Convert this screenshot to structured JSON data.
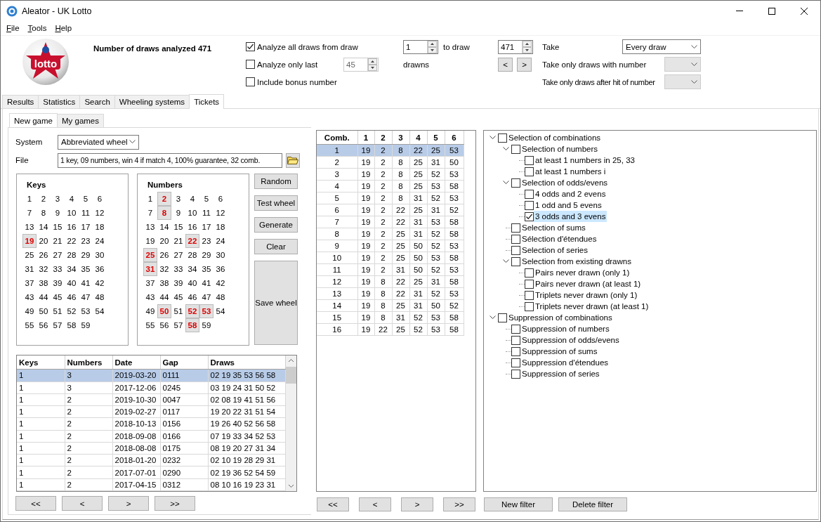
{
  "window": {
    "title": "Aleator - UK Lotto"
  },
  "menu": [
    "File",
    "Tools",
    "Help"
  ],
  "header": {
    "logo_text": "lotto",
    "summary": "Number of draws analyzed 471",
    "analyze_all": {
      "label": "Analyze all draws from draw",
      "checked": true
    },
    "from_draw": "1",
    "to_draw_label": "to draw",
    "to_draw": "471",
    "analyze_last": {
      "label": "Analyze only last",
      "checked": false
    },
    "last_count": {
      "value": "45",
      "disabled": true
    },
    "drawns_label": "drawns",
    "include_bonus": {
      "label": "Include bonus number",
      "checked": false
    },
    "prev": "<",
    "next": ">",
    "take_label": "Take",
    "take_value": "Every draw",
    "with_number": {
      "label": "Take only draws with number",
      "disabled": true
    },
    "after_hit": {
      "label": "Take only draws after hit of number",
      "disabled": true
    }
  },
  "tabs": [
    {
      "label": "Results",
      "selected": false
    },
    {
      "label": "Statistics",
      "selected": false
    },
    {
      "label": "Search",
      "selected": false
    },
    {
      "label": "Wheeling systems",
      "selected": false
    },
    {
      "label": "Tickets",
      "selected": true
    }
  ],
  "subtabs": [
    {
      "label": "New game",
      "selected": true
    },
    {
      "label": "My games",
      "selected": false
    }
  ],
  "system": {
    "label": "System",
    "value": "Abbreviated wheel"
  },
  "file": {
    "label": "File",
    "value": "1 key, 09 numbers, win 4 if match 4, 100% guarantee, 32 comb."
  },
  "keys": {
    "title": "Keys",
    "numbers": [
      {
        "n": "1",
        "selected": false
      },
      {
        "n": "2",
        "selected": false
      },
      {
        "n": "3",
        "selected": false
      },
      {
        "n": "4",
        "selected": false
      },
      {
        "n": "5",
        "selected": false
      },
      {
        "n": "6",
        "selected": false
      },
      {
        "n": "7",
        "selected": false
      },
      {
        "n": "8",
        "selected": false
      },
      {
        "n": "9",
        "selected": false
      },
      {
        "n": "10",
        "selected": false
      },
      {
        "n": "11",
        "selected": false
      },
      {
        "n": "12",
        "selected": false
      },
      {
        "n": "13",
        "selected": false
      },
      {
        "n": "14",
        "selected": false
      },
      {
        "n": "15",
        "selected": false
      },
      {
        "n": "16",
        "selected": false
      },
      {
        "n": "17",
        "selected": false
      },
      {
        "n": "18",
        "selected": false
      },
      {
        "n": "19",
        "selected": true
      },
      {
        "n": "20",
        "selected": false
      },
      {
        "n": "21",
        "selected": false
      },
      {
        "n": "22",
        "selected": false
      },
      {
        "n": "23",
        "selected": false
      },
      {
        "n": "24",
        "selected": false
      },
      {
        "n": "25",
        "selected": false
      },
      {
        "n": "26",
        "selected": false
      },
      {
        "n": "27",
        "selected": false
      },
      {
        "n": "28",
        "selected": false
      },
      {
        "n": "29",
        "selected": false
      },
      {
        "n": "30",
        "selected": false
      },
      {
        "n": "31",
        "selected": false
      },
      {
        "n": "32",
        "selected": false
      },
      {
        "n": "33",
        "selected": false
      },
      {
        "n": "34",
        "selected": false
      },
      {
        "n": "35",
        "selected": false
      },
      {
        "n": "36",
        "selected": false
      },
      {
        "n": "37",
        "selected": false
      },
      {
        "n": "38",
        "selected": false
      },
      {
        "n": "39",
        "selected": false
      },
      {
        "n": "40",
        "selected": false
      },
      {
        "n": "41",
        "selected": false
      },
      {
        "n": "42",
        "selected": false
      },
      {
        "n": "43",
        "selected": false
      },
      {
        "n": "44",
        "selected": false
      },
      {
        "n": "45",
        "selected": false
      },
      {
        "n": "46",
        "selected": false
      },
      {
        "n": "47",
        "selected": false
      },
      {
        "n": "48",
        "selected": false
      },
      {
        "n": "49",
        "selected": false
      },
      {
        "n": "50",
        "selected": false
      },
      {
        "n": "51",
        "selected": false
      },
      {
        "n": "52",
        "selected": false
      },
      {
        "n": "53",
        "selected": false
      },
      {
        "n": "54",
        "selected": false
      },
      {
        "n": "55",
        "selected": false
      },
      {
        "n": "56",
        "selected": false
      },
      {
        "n": "57",
        "selected": false
      },
      {
        "n": "58",
        "selected": false
      },
      {
        "n": "59",
        "selected": false
      }
    ]
  },
  "numbers": {
    "title": "Numbers",
    "numbers": [
      {
        "n": "1",
        "selected": false
      },
      {
        "n": "2",
        "selected": true
      },
      {
        "n": "3",
        "selected": false
      },
      {
        "n": "4",
        "selected": false
      },
      {
        "n": "5",
        "selected": false
      },
      {
        "n": "6",
        "selected": false
      },
      {
        "n": "7",
        "selected": false
      },
      {
        "n": "8",
        "selected": true
      },
      {
        "n": "9",
        "selected": false
      },
      {
        "n": "10",
        "selected": false
      },
      {
        "n": "11",
        "selected": false
      },
      {
        "n": "12",
        "selected": false
      },
      {
        "n": "13",
        "selected": false
      },
      {
        "n": "14",
        "selected": false
      },
      {
        "n": "15",
        "selected": false
      },
      {
        "n": "16",
        "selected": false
      },
      {
        "n": "17",
        "selected": false
      },
      {
        "n": "18",
        "selected": false
      },
      {
        "n": "19",
        "selected": false
      },
      {
        "n": "20",
        "selected": false
      },
      {
        "n": "21",
        "selected": false
      },
      {
        "n": "22",
        "selected": true
      },
      {
        "n": "23",
        "selected": false
      },
      {
        "n": "24",
        "selected": false
      },
      {
        "n": "25",
        "selected": true
      },
      {
        "n": "26",
        "selected": false
      },
      {
        "n": "27",
        "selected": false
      },
      {
        "n": "28",
        "selected": false
      },
      {
        "n": "29",
        "selected": false
      },
      {
        "n": "30",
        "selected": false
      },
      {
        "n": "31",
        "selected": true
      },
      {
        "n": "32",
        "selected": false
      },
      {
        "n": "33",
        "selected": false
      },
      {
        "n": "34",
        "selected": false
      },
      {
        "n": "35",
        "selected": false
      },
      {
        "n": "36",
        "selected": false
      },
      {
        "n": "37",
        "selected": false
      },
      {
        "n": "38",
        "selected": false
      },
      {
        "n": "39",
        "selected": false
      },
      {
        "n": "40",
        "selected": false
      },
      {
        "n": "41",
        "selected": false
      },
      {
        "n": "42",
        "selected": false
      },
      {
        "n": "43",
        "selected": false
      },
      {
        "n": "44",
        "selected": false
      },
      {
        "n": "45",
        "selected": false
      },
      {
        "n": "46",
        "selected": false
      },
      {
        "n": "47",
        "selected": false
      },
      {
        "n": "48",
        "selected": false
      },
      {
        "n": "49",
        "selected": false
      },
      {
        "n": "50",
        "selected": true
      },
      {
        "n": "51",
        "selected": false
      },
      {
        "n": "52",
        "selected": true
      },
      {
        "n": "53",
        "selected": true
      },
      {
        "n": "54",
        "selected": false
      },
      {
        "n": "55",
        "selected": false
      },
      {
        "n": "56",
        "selected": false
      },
      {
        "n": "57",
        "selected": false
      },
      {
        "n": "58",
        "selected": true
      },
      {
        "n": "59",
        "selected": false
      }
    ]
  },
  "actions": [
    "Random",
    "Test wheel",
    "Generate",
    "Clear",
    "Save wheel"
  ],
  "hits_table": {
    "columns": [
      "Keys",
      "Numbers",
      "Date",
      "Gap",
      "Draws"
    ],
    "rows": [
      {
        "cells": [
          "1",
          "3",
          "2019-03-20",
          "0111",
          "02 19 35 53 56 58"
        ],
        "selected": true
      },
      {
        "cells": [
          "1",
          "3",
          "2017-12-06",
          "0245",
          "03 19 24 31 50 52"
        ],
        "selected": false
      },
      {
        "cells": [
          "1",
          "2",
          "2019-10-30",
          "0047",
          "02 08 19 41 51 56"
        ],
        "selected": false
      },
      {
        "cells": [
          "1",
          "2",
          "2019-02-27",
          "0117",
          "19 20 22 31 51 54"
        ],
        "selected": false
      },
      {
        "cells": [
          "1",
          "2",
          "2018-10-13",
          "0156",
          "19 26 40 52 56 58"
        ],
        "selected": false
      },
      {
        "cells": [
          "1",
          "2",
          "2018-09-08",
          "0166",
          "07 19 33 34 52 53"
        ],
        "selected": false
      },
      {
        "cells": [
          "1",
          "2",
          "2018-08-08",
          "0175",
          "08 19 20 27 31 34"
        ],
        "selected": false
      },
      {
        "cells": [
          "1",
          "2",
          "2018-01-20",
          "0232",
          "02 10 19 28 29 31"
        ],
        "selected": false
      },
      {
        "cells": [
          "1",
          "2",
          "2017-07-01",
          "0290",
          "02 19 36 52 54 59"
        ],
        "selected": false
      },
      {
        "cells": [
          "1",
          "2",
          "2017-04-15",
          "0312",
          "08 10 16 19 23 31"
        ],
        "selected": false
      }
    ]
  },
  "hits_nav": [
    "<<",
    "<",
    ">",
    ">>"
  ],
  "combinations": {
    "columns": [
      "Comb.",
      "1",
      "2",
      "3",
      "4",
      "5",
      "6"
    ],
    "rows": [
      {
        "cells": [
          "1",
          "19",
          "2",
          "8",
          "22",
          "25",
          "53"
        ],
        "selected": true
      },
      {
        "cells": [
          "2",
          "19",
          "2",
          "8",
          "25",
          "31",
          "50"
        ],
        "selected": false
      },
      {
        "cells": [
          "3",
          "19",
          "2",
          "8",
          "25",
          "52",
          "53"
        ],
        "selected": false
      },
      {
        "cells": [
          "4",
          "19",
          "2",
          "8",
          "25",
          "53",
          "58"
        ],
        "selected": false
      },
      {
        "cells": [
          "5",
          "19",
          "2",
          "8",
          "31",
          "52",
          "53"
        ],
        "selected": false
      },
      {
        "cells": [
          "6",
          "19",
          "2",
          "22",
          "25",
          "31",
          "52"
        ],
        "selected": false
      },
      {
        "cells": [
          "7",
          "19",
          "2",
          "22",
          "31",
          "53",
          "58"
        ],
        "selected": false
      },
      {
        "cells": [
          "8",
          "19",
          "2",
          "25",
          "31",
          "52",
          "58"
        ],
        "selected": false
      },
      {
        "cells": [
          "9",
          "19",
          "2",
          "25",
          "50",
          "52",
          "53"
        ],
        "selected": false
      },
      {
        "cells": [
          "10",
          "19",
          "2",
          "25",
          "50",
          "53",
          "58"
        ],
        "selected": false
      },
      {
        "cells": [
          "11",
          "19",
          "2",
          "31",
          "50",
          "52",
          "53"
        ],
        "selected": false
      },
      {
        "cells": [
          "12",
          "19",
          "8",
          "22",
          "25",
          "31",
          "58"
        ],
        "selected": false
      },
      {
        "cells": [
          "13",
          "19",
          "8",
          "22",
          "31",
          "52",
          "53"
        ],
        "selected": false
      },
      {
        "cells": [
          "14",
          "19",
          "8",
          "25",
          "31",
          "50",
          "52"
        ],
        "selected": false
      },
      {
        "cells": [
          "15",
          "19",
          "8",
          "31",
          "52",
          "53",
          "58"
        ],
        "selected": false
      },
      {
        "cells": [
          "16",
          "19",
          "22",
          "25",
          "52",
          "53",
          "58"
        ],
        "selected": false
      }
    ]
  },
  "comb_nav": [
    "<<",
    "<",
    ">",
    ">>"
  ],
  "filters": [
    {
      "label": "Selection of combinations",
      "checked": false,
      "selected": false,
      "expanded": true,
      "children": [
        {
          "label": "Selection of numbers",
          "checked": false,
          "selected": false,
          "expanded": true,
          "children": [
            {
              "label": "at least 1 numbers in 25, 33",
              "checked": false,
              "selected": false
            },
            {
              "label": "at least 1 numbers i",
              "checked": false,
              "selected": false
            }
          ]
        },
        {
          "label": "Selection of odds/evens",
          "checked": false,
          "selected": false,
          "expanded": true,
          "children": [
            {
              "label": "4 odds and 2 evens",
              "checked": false,
              "selected": false
            },
            {
              "label": "1 odd and 5 evens",
              "checked": false,
              "selected": false
            },
            {
              "label": "3 odds and 3 evens",
              "checked": true,
              "selected": true
            }
          ]
        },
        {
          "label": "Selection of sums",
          "checked": false,
          "selected": false
        },
        {
          "label": "Sélection d'étendues",
          "checked": false,
          "selected": false
        },
        {
          "label": "Selection of series",
          "checked": false,
          "selected": false
        },
        {
          "label": "Selection from existing drawns",
          "checked": false,
          "selected": false,
          "expanded": true,
          "children": [
            {
              "label": "Pairs never drawn (only 1)",
              "checked": false,
              "selected": false
            },
            {
              "label": "Pairs never drawn (at least 1)",
              "checked": false,
              "selected": false
            },
            {
              "label": "Triplets never drawn (only 1)",
              "checked": false,
              "selected": false
            },
            {
              "label": "Triplets never drawn (at least 1)",
              "checked": false,
              "selected": false
            }
          ]
        }
      ]
    },
    {
      "label": "Suppression of combinations",
      "checked": false,
      "selected": false,
      "expanded": true,
      "children": [
        {
          "label": "Suppression of numbers",
          "checked": false,
          "selected": false
        },
        {
          "label": "Suppression of odds/evens",
          "checked": false,
          "selected": false
        },
        {
          "label": "Suppression of sums",
          "checked": false,
          "selected": false
        },
        {
          "label": "Suppression d'étendues",
          "checked": false,
          "selected": false
        },
        {
          "label": "Suppression of series",
          "checked": false,
          "selected": false
        }
      ]
    }
  ],
  "filter_buttons": [
    "New filter",
    "Delete filter"
  ]
}
